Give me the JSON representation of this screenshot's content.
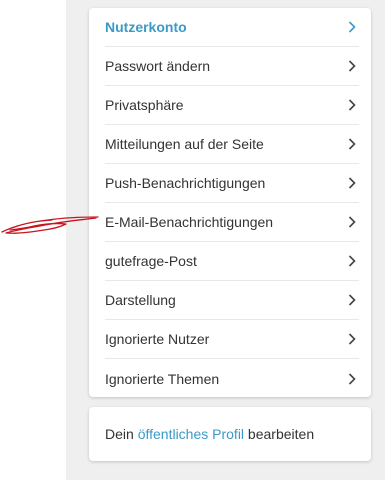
{
  "colors": {
    "accent": "#3a9bc7",
    "text": "#333333",
    "background": "#efefef",
    "annotation": "#c8141e"
  },
  "menu": {
    "items": [
      {
        "label": "Nutzerkonto",
        "active": true
      },
      {
        "label": "Passwort ändern"
      },
      {
        "label": "Privatsphäre"
      },
      {
        "label": "Mitteilungen auf der Seite"
      },
      {
        "label": "Push-Benachrichtigungen"
      },
      {
        "label": "E-Mail-Benachrichtigungen"
      },
      {
        "label": "gutefrage-Post"
      },
      {
        "label": "Darstellung"
      },
      {
        "label": "Ignorierte Nutzer"
      },
      {
        "label": "Ignorierte Themen"
      }
    ]
  },
  "profile": {
    "prefix": "Dein ",
    "link": "öffentliches Profil",
    "suffix": " bearbeiten"
  }
}
